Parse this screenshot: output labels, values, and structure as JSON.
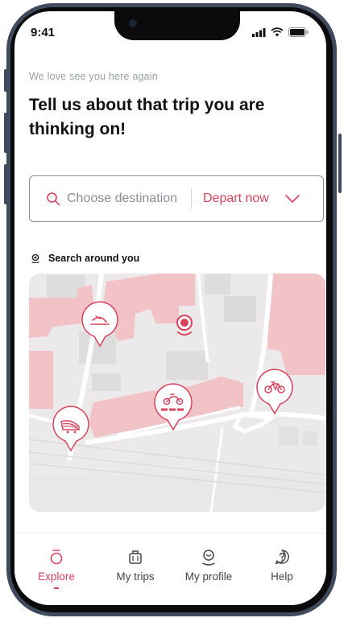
{
  "status_bar": {
    "time": "9:41"
  },
  "greeting": "We love see you here again",
  "headline": "Tell us about  that trip you are thinking on!",
  "search": {
    "placeholder": "Choose destination",
    "depart_label": "Depart now"
  },
  "nearby": {
    "label": "Search around you"
  },
  "map": {
    "markers": [
      {
        "name": "map-marker-scooter",
        "icon": "scooter-icon"
      },
      {
        "name": "map-marker-user-location",
        "icon": "location-pin-icon"
      },
      {
        "name": "map-marker-scooter-2",
        "icon": "scooter-icon"
      },
      {
        "name": "map-marker-motorbike",
        "icon": "motorbike-icon"
      },
      {
        "name": "map-marker-bicycle",
        "icon": "bicycle-icon"
      }
    ]
  },
  "tabs": [
    {
      "label": "Explore",
      "icon": "explore-icon",
      "active": true
    },
    {
      "label": "My trips",
      "icon": "luggage-icon",
      "active": false
    },
    {
      "label": "My profile",
      "icon": "profile-icon",
      "active": false
    },
    {
      "label": "Help",
      "icon": "help-icon",
      "active": false
    }
  ],
  "colors": {
    "accent": "#d8435b",
    "map_building": "#f1c3c6",
    "map_ground": "#ebe9e9",
    "frame": "#3f4b5c"
  }
}
